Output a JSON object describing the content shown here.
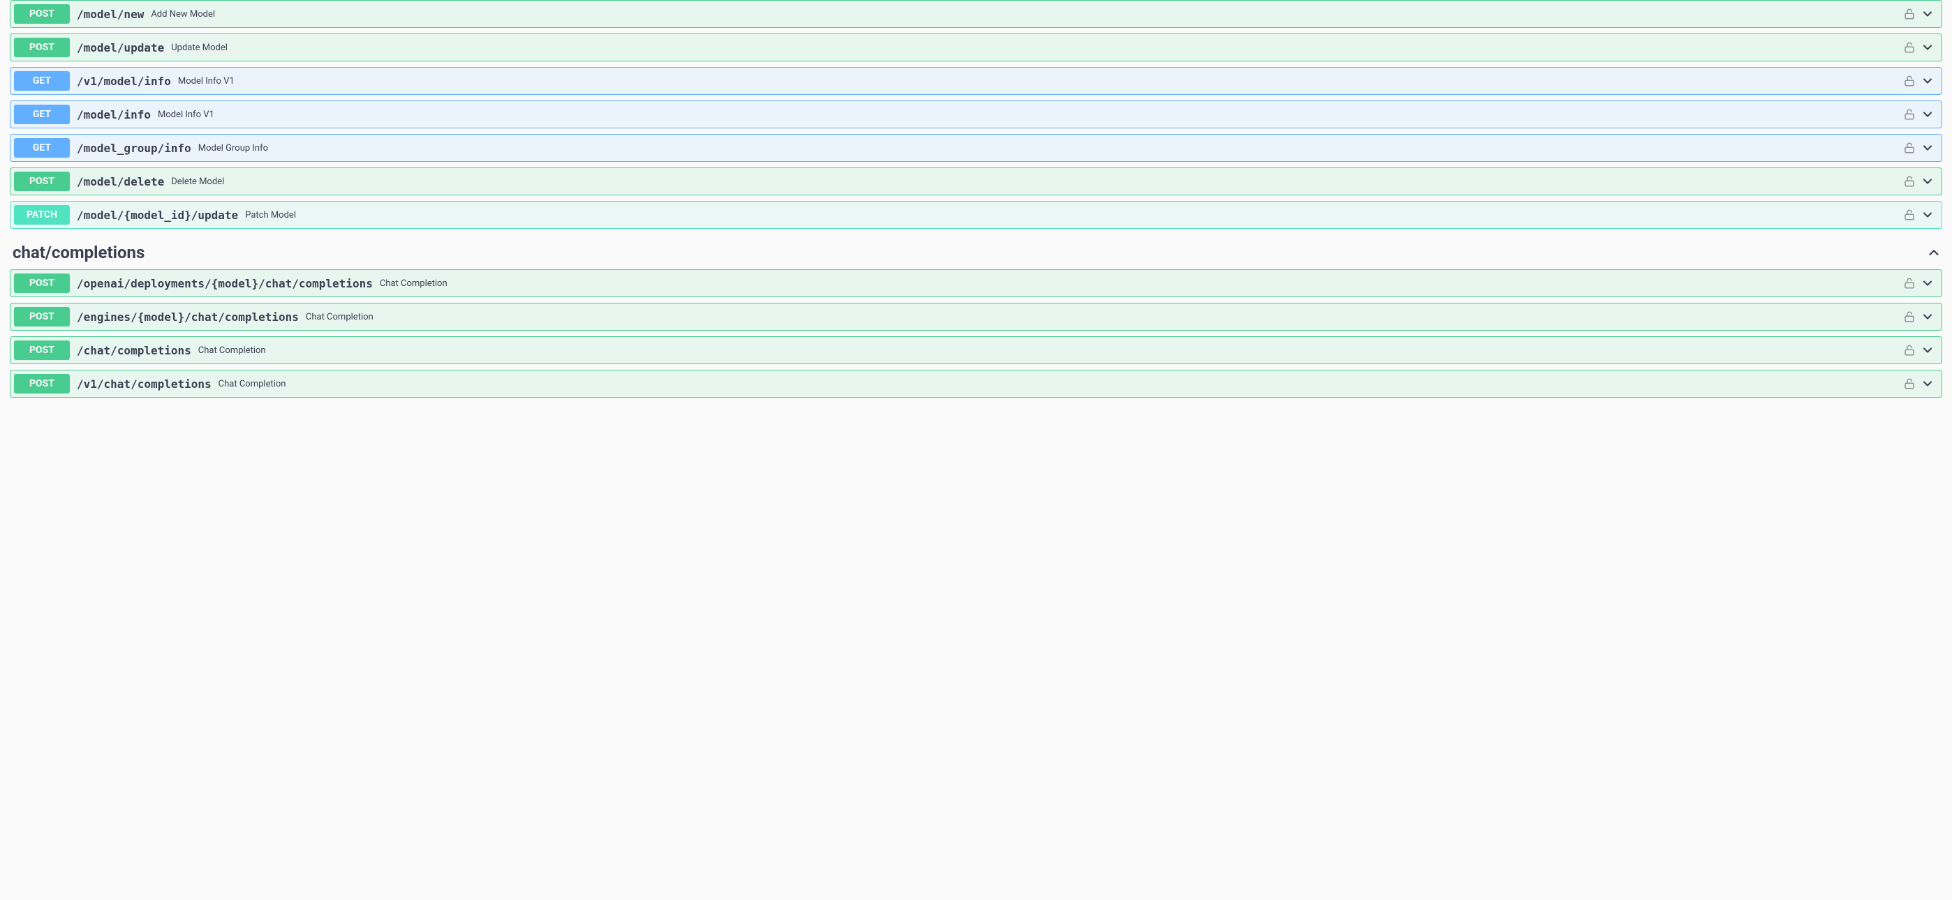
{
  "groups": [
    {
      "title": null,
      "open": true,
      "endpoints": [
        {
          "method": "POST",
          "path": "/model/new",
          "summary": "Add New Model"
        },
        {
          "method": "POST",
          "path": "/model/update",
          "summary": "Update Model"
        },
        {
          "method": "GET",
          "path": "/v1/model/info",
          "summary": "Model Info V1"
        },
        {
          "method": "GET",
          "path": "/model/info",
          "summary": "Model Info V1"
        },
        {
          "method": "GET",
          "path": "/model_group/info",
          "summary": "Model Group Info"
        },
        {
          "method": "POST",
          "path": "/model/delete",
          "summary": "Delete Model"
        },
        {
          "method": "PATCH",
          "path": "/model/{model_id}/update",
          "summary": "Patch Model"
        }
      ]
    },
    {
      "title": "chat/completions",
      "open": true,
      "endpoints": [
        {
          "method": "POST",
          "path": "/openai/deployments/{model}/chat/completions",
          "summary": "Chat Completion"
        },
        {
          "method": "POST",
          "path": "/engines/{model}/chat/completions",
          "summary": "Chat Completion"
        },
        {
          "method": "POST",
          "path": "/chat/completions",
          "summary": "Chat Completion"
        },
        {
          "method": "POST",
          "path": "/v1/chat/completions",
          "summary": "Chat Completion"
        }
      ]
    }
  ]
}
